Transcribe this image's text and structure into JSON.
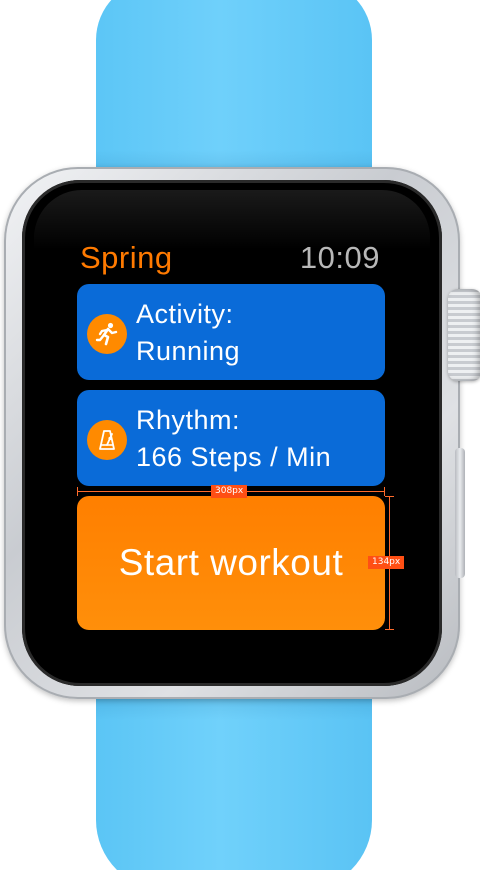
{
  "app": {
    "title": "Spring",
    "time": "10:09"
  },
  "activity_card": {
    "label": "Activity:",
    "value": "Running",
    "icon": "running-person-icon"
  },
  "rhythm_card": {
    "label": "Rhythm:",
    "value": "166 Steps / Min",
    "icon": "metronome-icon"
  },
  "start_button": {
    "label": "Start workout"
  },
  "annotations": {
    "width_label": "308px",
    "height_label": "134px"
  },
  "colors": {
    "accent_orange": "#ff7f00",
    "card_blue": "#0a6bd8",
    "band_blue": "#5ec7f7",
    "clock_gray": "#b8b8b8",
    "annotation_red": "#ff4f14"
  }
}
